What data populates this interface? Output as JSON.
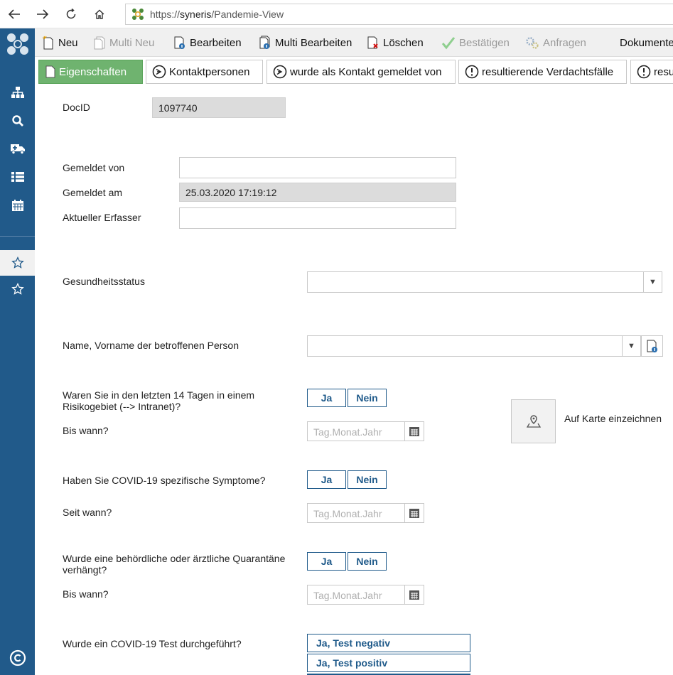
{
  "browser": {
    "url_scheme": "https://",
    "url_host": "syneris",
    "url_path": "/Pandemie-View"
  },
  "toolbar": {
    "neu": "Neu",
    "multi_neu": "Multi Neu",
    "bearbeiten": "Bearbeiten",
    "multi_bearbeiten": "Multi Bearbeiten",
    "loeschen": "Löschen",
    "bestaetigen": "Bestätigen",
    "anfragen": "Anfragen",
    "dokumente": "Dokumente"
  },
  "tabs": [
    {
      "label": "Eigenschaften"
    },
    {
      "label": "Kontaktpersonen"
    },
    {
      "label": "wurde als Kontakt gemeldet von"
    },
    {
      "label": "resultierende Verdachtsfälle"
    },
    {
      "label": "resu"
    }
  ],
  "form": {
    "docid_label": "DocID",
    "docid_value": "1097740",
    "gemeldet_von_label": "Gemeldet von",
    "gemeldet_von_value": "",
    "gemeldet_am_label": "Gemeldet am",
    "gemeldet_am_value": "25.03.2020 17:19:12",
    "erfasser_label": "Aktueller Erfasser",
    "erfasser_value": "",
    "gesundheitsstatus_label": "Gesundheitsstatus",
    "gesundheitsstatus_value": "",
    "person_label": "Name, Vorname der betroffenen Person",
    "person_value": "",
    "risikogebiet_label_1": "Waren Sie in den letzten 14 Tagen in einem",
    "risikogebiet_label_2": "Risikogebiet (--> Intranet)?",
    "bis_wann_label": "Bis wann?",
    "symptome_label": "Haben Sie COVID-19 spezifische Symptome?",
    "seit_wann_label": "Seit wann?",
    "quarantaene_label_1": "Wurde eine behördliche oder ärztliche Quarantäne",
    "quarantaene_label_2": "verhängt?",
    "bis_wann_label_2": "Bis wann?",
    "test_label": "Wurde ein COVID-19 Test durchgeführt?",
    "ja": "Ja",
    "nein": "Nein",
    "date_placeholder": "Tag.Monat.Jahr",
    "test_negativ": "Ja, Test negativ",
    "test_positiv": "Ja, Test positiv",
    "karte_label": "Auf Karte einzeichnen"
  },
  "colors": {
    "sidebar": "#215a8a",
    "accent": "#1f5a8a",
    "active_tab": "#6fb36f"
  }
}
